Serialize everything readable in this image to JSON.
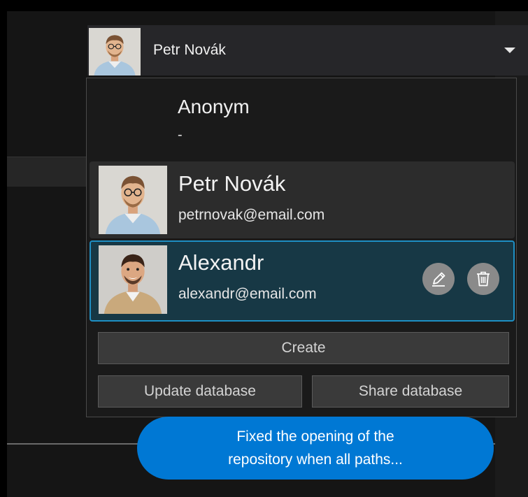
{
  "current_user": {
    "name": "Petr Novák"
  },
  "dropdown": {
    "anonymous": {
      "name": "Anonym",
      "email": "-"
    },
    "users": [
      {
        "name": "Petr Novák",
        "email": "petrnovak@email.com",
        "selected": false
      },
      {
        "name": "Alexandr",
        "email": "alexandr@email.com",
        "selected": true
      }
    ],
    "actions": {
      "create_label": "Create",
      "update_label": "Update database",
      "share_label": "Share database"
    }
  },
  "notification": {
    "line1": "Fixed the opening of the",
    "line2": "repository when all paths..."
  },
  "colors": {
    "accent": "#0078d4",
    "selected_border": "#1e8fc4",
    "selected_bg": "#173845"
  },
  "icons": [
    "chevron-down-icon",
    "pencil-icon",
    "trash-icon"
  ]
}
